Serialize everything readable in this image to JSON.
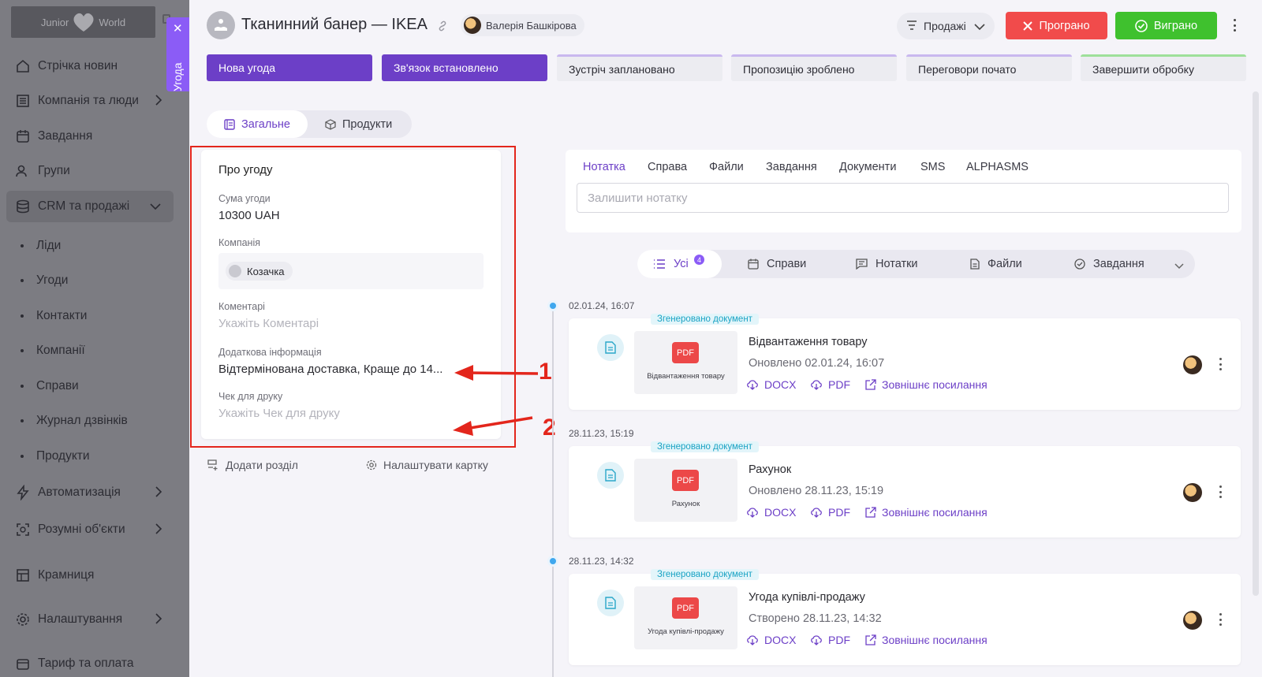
{
  "sidebar": {
    "logo_left": "Junior",
    "logo_right": "World",
    "items": [
      {
        "label": "Стрічка новин",
        "icon": "home-icon"
      },
      {
        "label": "Компанія та люди",
        "icon": "building-icon"
      },
      {
        "label": "Завдання",
        "icon": "calendar-icon"
      },
      {
        "label": "Групи",
        "icon": "users-icon"
      },
      {
        "label": "CRM та продажі",
        "icon": "database-icon"
      },
      {
        "label": "Автоматизація",
        "icon": "lightning-icon"
      },
      {
        "label": "Розумні об'єкти",
        "icon": "smart-object-icon"
      },
      {
        "label": "Крамниця",
        "icon": "store-icon"
      },
      {
        "label": "Налаштування",
        "icon": "gear-icon"
      },
      {
        "label": "Тариф та оплата",
        "icon": "wallet-icon"
      }
    ],
    "crm_sub": [
      "Ліди",
      "Угоди",
      "Контакти",
      "Компанії",
      "Справи",
      "Журнал дзвінків",
      "Продукти"
    ],
    "side_tab": "Угода"
  },
  "header": {
    "title": "Тканинний банер — IKEA",
    "owner": "Валерія Башкірова",
    "funnel": "Продажі",
    "lost": "Програно",
    "won": "Виграно"
  },
  "stages": [
    "Нова угода",
    "Зв'язок встановлено",
    "Зустріч заплановано",
    "Пропозицію зроблено",
    "Переговори почато",
    "Завершити обробку"
  ],
  "tabs": {
    "general": "Загальне",
    "products": "Продукти"
  },
  "deal_card": {
    "title": "Про угоду",
    "amount_label": "Сума угоди",
    "amount": "10300 UAH",
    "company_label": "Компанія",
    "company": "Козачка",
    "comments_label": "Коментарі",
    "comments_placeholder": "Укажіть Коментарі",
    "extra_label": "Додаткова інформація",
    "extra_value": "Відтермінована доставка, Краще до 14...",
    "receipt_label": "Чек для друку",
    "receipt_placeholder": "Укажіть Чек для друку",
    "add_section": "Додати розділ",
    "configure": "Налаштувати картку"
  },
  "annotations": [
    "1",
    "2"
  ],
  "composer": {
    "tabs": [
      "Нотатка",
      "Справа",
      "Файли",
      "Завдання",
      "Документи",
      "SMS",
      "ALPHASMS"
    ],
    "placeholder": "Залишити нотатку"
  },
  "filters": {
    "all": "Усі",
    "all_count": "4",
    "cases": "Справи",
    "notes": "Нотатки",
    "files": "Файли",
    "tasks": "Завдання"
  },
  "timeline": [
    {
      "date": "02.01.24, 16:07",
      "badge": "Згенеровано документ",
      "title": "Відвантаження товару",
      "updated": "Оновлено 02.01.24, 16:07",
      "thumb_label": "PDF",
      "thumb_name": "Відвантаження товару",
      "docx": "DOCX",
      "pdf": "PDF",
      "external": "Зовнішнє посилання"
    },
    {
      "date": "28.11.23, 15:19",
      "badge": "Згенеровано документ",
      "title": "Рахунок",
      "updated": "Оновлено 28.11.23, 15:19",
      "thumb_label": "PDF",
      "thumb_name": "Рахунок",
      "docx": "DOCX",
      "pdf": "PDF",
      "external": "Зовнішнє посилання"
    },
    {
      "date": "28.11.23, 14:32",
      "badge": "Згенеровано документ",
      "title": "Угода купівлі-продажу",
      "updated": "Створено 28.11.23, 14:32",
      "thumb_label": "PDF",
      "thumb_name": "Угода купівлі-продажу",
      "docx": "DOCX",
      "pdf": "PDF",
      "external": "Зовнішнє посилання"
    }
  ],
  "colors": {
    "accent": "#6c3fc7",
    "lost": "#f14b4b",
    "won": "#3fc12e",
    "annotation": "#e3261c",
    "sidebar_overlay": "#7c7c82"
  }
}
